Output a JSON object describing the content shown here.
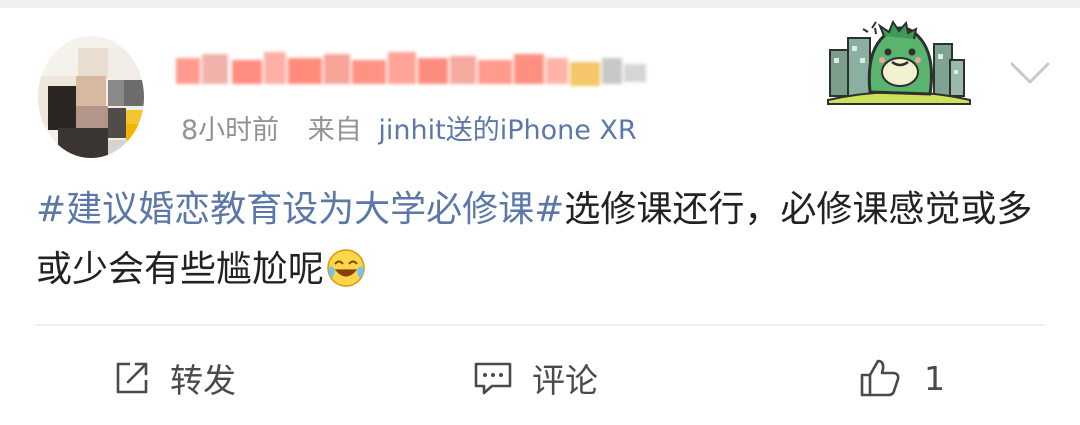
{
  "post": {
    "author": {
      "name_redacted": true
    },
    "meta": {
      "time": "8小时前",
      "source_prefix": "来自",
      "device": "jinhit送的iPhone XR"
    },
    "content": {
      "topic": "#建议婚恋教育设为大学必修课#",
      "text": "选修课还行，必修课感觉或多或少会有些尴尬呢",
      "emoji": "laugh-cry-emoji"
    },
    "actions": {
      "repost": {
        "label": "转发",
        "icon": "share-icon"
      },
      "comment": {
        "label": "评论",
        "icon": "comment-icon"
      },
      "like": {
        "count": "1",
        "icon": "thumbs-up-icon"
      }
    },
    "menu_icon": "chevron-down-icon",
    "sticker_icon": "dinosaur-sticker-icon"
  },
  "colors": {
    "link": "#5b78a8",
    "meta_text": "#939393",
    "body_text": "#222222",
    "divider": "#efefef"
  }
}
